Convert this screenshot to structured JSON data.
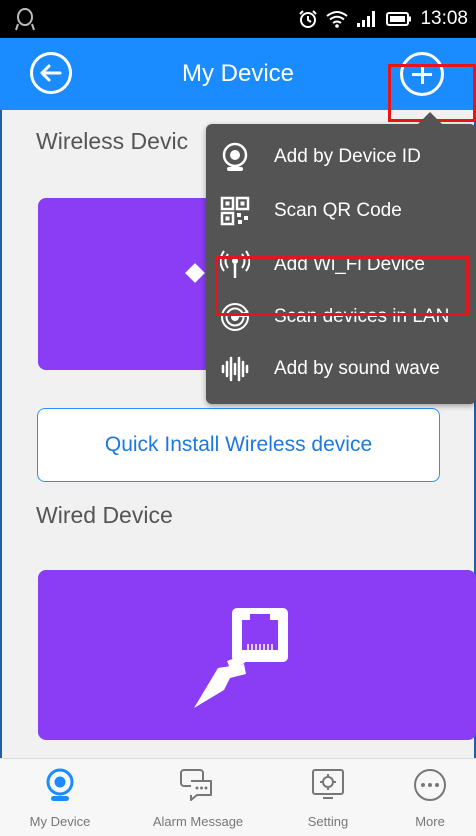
{
  "status_bar": {
    "time": "13:08",
    "icons": [
      "notification-icon",
      "alarm-clock-icon",
      "wifi-icon",
      "signal-icon",
      "battery-icon"
    ]
  },
  "app_bar": {
    "title": "My Device",
    "back_icon": "back-arrow-icon",
    "add_icon": "plus-icon"
  },
  "content": {
    "wireless_section_title": "Wireless Devic",
    "quick_install_label": "Quick Install Wireless device",
    "wired_section_title": "Wired Device"
  },
  "popup_menu": {
    "items": [
      {
        "label": "Add by Device ID",
        "icon": "camera-icon"
      },
      {
        "label": "Scan QR Code",
        "icon": "qr-code-icon"
      },
      {
        "label": "Add Wi_Fi Device",
        "icon": "antenna-icon"
      },
      {
        "label": "Scan devices in LAN",
        "icon": "radar-icon"
      },
      {
        "label": "Add by sound wave",
        "icon": "sound-wave-icon"
      }
    ]
  },
  "bottom_nav": {
    "items": [
      {
        "label": "My Device",
        "icon": "camera-icon",
        "active": true
      },
      {
        "label": "Alarm Message",
        "icon": "chat-icon",
        "active": false
      },
      {
        "label": "Setting",
        "icon": "settings-icon",
        "active": false
      },
      {
        "label": "More",
        "icon": "more-icon",
        "active": false
      }
    ]
  },
  "colors": {
    "primary": "#1a8cff",
    "card": "#8a3df5",
    "menu_bg": "#555455",
    "highlight": "#e8141c"
  }
}
